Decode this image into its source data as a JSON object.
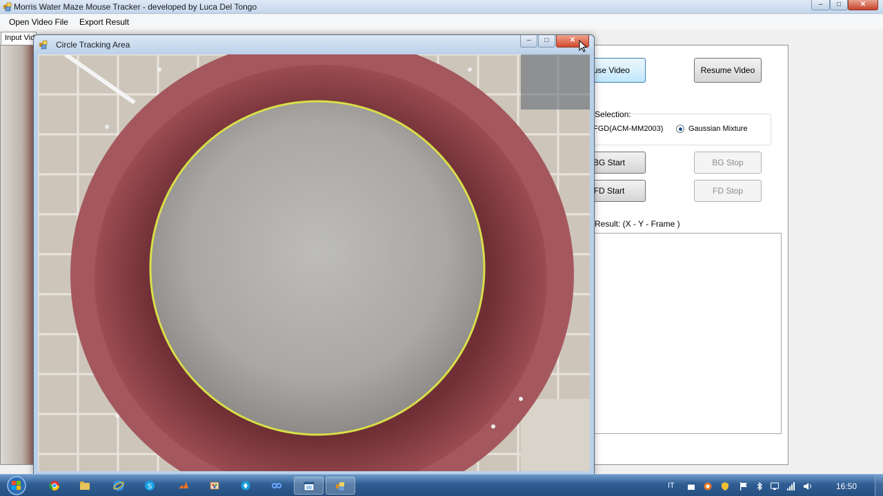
{
  "main_window": {
    "title": "Morris Water Maze Mouse Tracker - developed by Luca Del Tongo",
    "menu": [
      "Open Video File",
      "Export Result"
    ],
    "tabs": [
      "Input Video"
    ],
    "buttons": {
      "pause": "ause Video",
      "resume": "Resume Video",
      "bg_start": "BG Start",
      "bg_stop": "BG Stop",
      "fd_start": "FD Start",
      "fd_stop": "FD Stop"
    },
    "detector_selection": {
      "legend": "ector Selection:",
      "options": [
        "FGD(ACM-MM2003)",
        "Gaussian Mixture"
      ],
      "selected": "Gaussian Mixture"
    },
    "result_label": "Result: (X - Y - Frame )"
  },
  "child_window": {
    "title": "Circle Tracking Area",
    "tracking_circle_color": "#d8e048",
    "maze_wall_color": "#8a3e45"
  },
  "taskbar": {
    "items": [
      "chrome-icon",
      "folder-icon",
      "ie-icon",
      "skype-icon",
      "matlab-icon",
      "paint-icon",
      "app-icon",
      "infinity-icon",
      "window-icon",
      "tracker-icon"
    ],
    "active_item": "tracker-icon",
    "language": "IT",
    "clock": "16:50"
  },
  "colors": {
    "titlebar": "#c4d6ec",
    "taskbar": "#2f5d93",
    "close_button": "#c7432c"
  }
}
